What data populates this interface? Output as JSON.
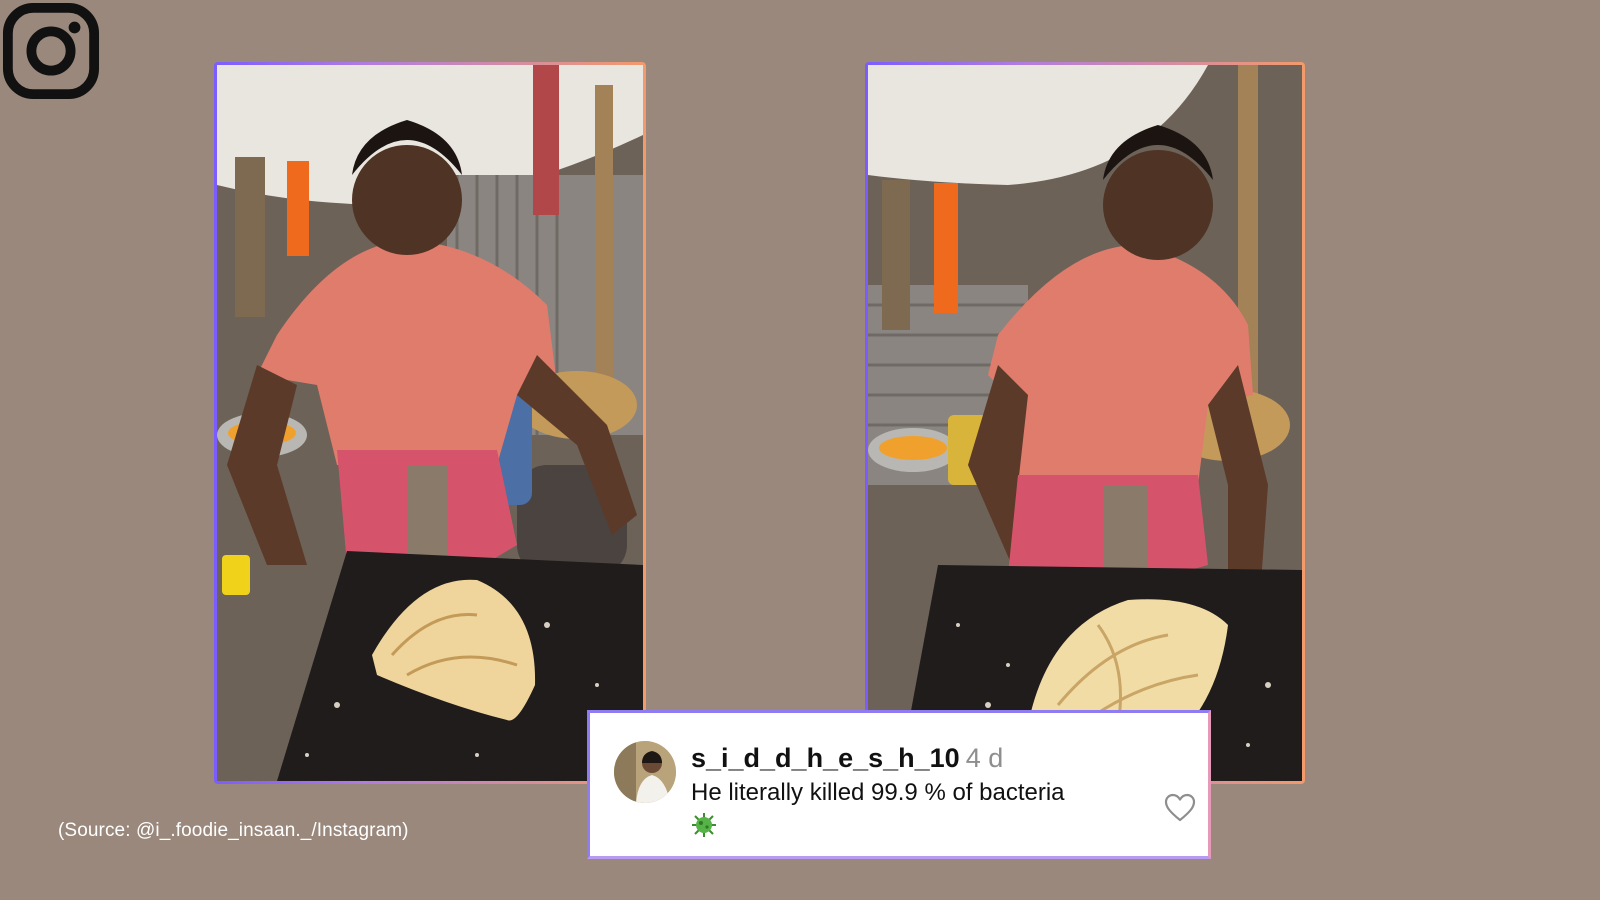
{
  "branding": {
    "logo_icon": "instagram-logo-icon"
  },
  "photos": [
    {
      "subject": "cook-with-flatbread-photo",
      "icon": "photo-left"
    },
    {
      "subject": "cook-crushing-flatbread-photo",
      "icon": "photo-right"
    }
  ],
  "source": {
    "caption": "(Source: @i_.foodie_insaan._/Instagram)"
  },
  "comment": {
    "username": "s_i_d_d_h_e_s_h_10",
    "time": "4 d",
    "text": "He literally killed 99.9 % of bacteria",
    "emoji_icon": "microbe-icon",
    "like_icon": "heart-outline-icon"
  },
  "colors": {
    "background": "#9a887c",
    "frame_gradient_start": "#7b5cff",
    "frame_gradient_end": "#f39a6b",
    "card_border": "#8f7cf2",
    "username": "#111111",
    "time": "#8e8e8e"
  }
}
